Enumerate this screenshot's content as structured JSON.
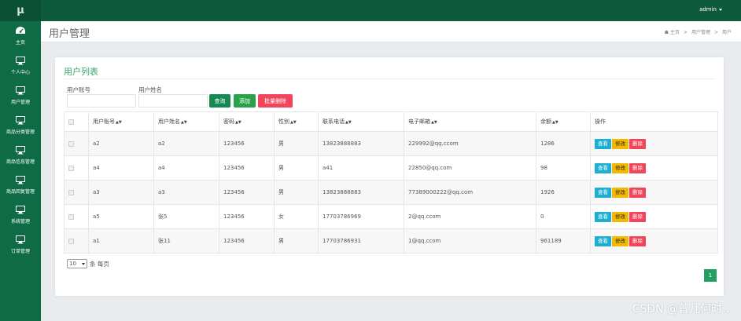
{
  "app": {
    "logo": "μ",
    "user": "admin"
  },
  "colors": {
    "topbar": "#0e5a3d",
    "sidebar": "#0e6b45",
    "accent": "#3aa56a",
    "view": "#1eaecf",
    "edit": "#f5b800",
    "delete": "#f2455b"
  },
  "sidebar": {
    "items": [
      {
        "label": "主页",
        "icon": "dashboard-icon"
      },
      {
        "label": "个人中心",
        "icon": "monitor-icon"
      },
      {
        "label": "用户管理",
        "icon": "monitor-icon"
      },
      {
        "label": "商品分类管理",
        "icon": "monitor-icon"
      },
      {
        "label": "商品信息管理",
        "icon": "monitor-icon"
      },
      {
        "label": "商品回复管理",
        "icon": "monitor-icon"
      },
      {
        "label": "系统管理",
        "icon": "monitor-icon"
      },
      {
        "label": "订单管理",
        "icon": "monitor-icon"
      }
    ]
  },
  "header": {
    "title": "用户管理",
    "breadcrumb": [
      "主页",
      "用户管理",
      "用户"
    ]
  },
  "card": {
    "title": "用户列表"
  },
  "search": {
    "account_label": "用户账号",
    "name_label": "用户姓名",
    "account_value": "",
    "name_value": "",
    "query_btn": "查询",
    "add_btn": "添加",
    "batch_delete_btn": "批量删除"
  },
  "table": {
    "headers": [
      "用户账号",
      "用户姓名",
      "密码",
      "性别",
      "联系电话",
      "电子邮箱",
      "余额",
      "操作"
    ],
    "sortable": [
      true,
      true,
      true,
      true,
      true,
      true,
      true,
      false
    ],
    "actions": {
      "view": "查看",
      "edit": "修改",
      "delete": "删除"
    },
    "rows": [
      [
        "a2",
        "a2",
        "123456",
        "男",
        "13823888883",
        "229992@qq.ccom",
        "1286"
      ],
      [
        "a4",
        "a4",
        "123456",
        "男",
        "a41",
        "22850@qq.com",
        "98"
      ],
      [
        "a3",
        "a3",
        "123456",
        "男",
        "13823888883",
        "77389000222@qq.com",
        "1926"
      ],
      [
        "a5",
        "张5",
        "123456",
        "女",
        "17703786969",
        "2@qq.ccom",
        "0"
      ],
      [
        "a1",
        "张11",
        "123456",
        "男",
        "17703786931",
        "1@qq.ccom",
        "961189"
      ]
    ]
  },
  "pagination": {
    "page_size": "10",
    "per_page_text": "条 每页",
    "current_page": "1"
  },
  "watermark": "CSDN @曾几何时…"
}
